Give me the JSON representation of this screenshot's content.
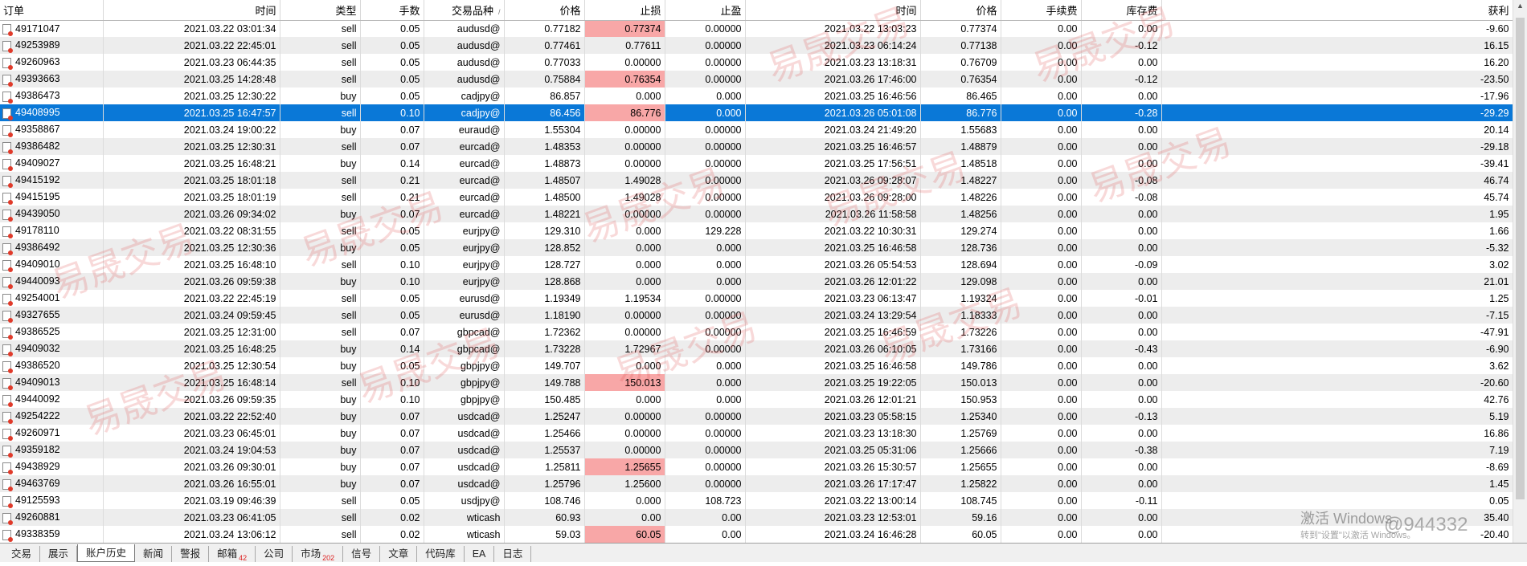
{
  "columns": [
    "订单",
    "时间",
    "类型",
    "手数",
    "交易品种",
    "价格",
    "止损",
    "止盈",
    "时间",
    "价格",
    "手续费",
    "库存费",
    "获利"
  ],
  "sort_mark": "/",
  "rows": [
    [
      "49171047",
      "2021.03.22 03:01:34",
      "sell",
      "0.05",
      "audusd@",
      "0.77182",
      "0.77374",
      "0.00000",
      "2021.03.22 13:03:23",
      "0.77374",
      "0.00",
      "0.00",
      "-9.60"
    ],
    [
      "49253989",
      "2021.03.22 22:45:01",
      "sell",
      "0.05",
      "audusd@",
      "0.77461",
      "0.77611",
      "0.00000",
      "2021.03.23 06:14:24",
      "0.77138",
      "0.00",
      "-0.12",
      "16.15"
    ],
    [
      "49260963",
      "2021.03.23 06:44:35",
      "sell",
      "0.05",
      "audusd@",
      "0.77033",
      "0.00000",
      "0.00000",
      "2021.03.23 13:18:31",
      "0.76709",
      "0.00",
      "0.00",
      "16.20"
    ],
    [
      "49393663",
      "2021.03.25 14:28:48",
      "sell",
      "0.05",
      "audusd@",
      "0.75884",
      "0.76354",
      "0.00000",
      "2021.03.26 17:46:00",
      "0.76354",
      "0.00",
      "-0.12",
      "-23.50"
    ],
    [
      "49386473",
      "2021.03.25 12:30:22",
      "buy",
      "0.05",
      "cadjpy@",
      "86.857",
      "0.000",
      "0.000",
      "2021.03.25 16:46:56",
      "86.465",
      "0.00",
      "0.00",
      "-17.96"
    ],
    [
      "49408995",
      "2021.03.25 16:47:57",
      "sell",
      "0.10",
      "cadjpy@",
      "86.456",
      "86.776",
      "0.000",
      "2021.03.26 05:01:08",
      "86.776",
      "0.00",
      "-0.28",
      "-29.29"
    ],
    [
      "49358867",
      "2021.03.24 19:00:22",
      "buy",
      "0.07",
      "euraud@",
      "1.55304",
      "0.00000",
      "0.00000",
      "2021.03.24 21:49:20",
      "1.55683",
      "0.00",
      "0.00",
      "20.14"
    ],
    [
      "49386482",
      "2021.03.25 12:30:31",
      "sell",
      "0.07",
      "eurcad@",
      "1.48353",
      "0.00000",
      "0.00000",
      "2021.03.25 16:46:57",
      "1.48879",
      "0.00",
      "0.00",
      "-29.18"
    ],
    [
      "49409027",
      "2021.03.25 16:48:21",
      "buy",
      "0.14",
      "eurcad@",
      "1.48873",
      "0.00000",
      "0.00000",
      "2021.03.25 17:56:51",
      "1.48518",
      "0.00",
      "0.00",
      "-39.41"
    ],
    [
      "49415192",
      "2021.03.25 18:01:18",
      "sell",
      "0.21",
      "eurcad@",
      "1.48507",
      "1.49028",
      "0.00000",
      "2021.03.26 09:28:07",
      "1.48227",
      "0.00",
      "-0.08",
      "46.74"
    ],
    [
      "49415195",
      "2021.03.25 18:01:19",
      "sell",
      "0.21",
      "eurcad@",
      "1.48500",
      "1.49028",
      "0.00000",
      "2021.03.26 09:28:00",
      "1.48226",
      "0.00",
      "-0.08",
      "45.74"
    ],
    [
      "49439050",
      "2021.03.26 09:34:02",
      "buy",
      "0.07",
      "eurcad@",
      "1.48221",
      "0.00000",
      "0.00000",
      "2021.03.26 11:58:58",
      "1.48256",
      "0.00",
      "0.00",
      "1.95"
    ],
    [
      "49178110",
      "2021.03.22 08:31:55",
      "sell",
      "0.05",
      "eurjpy@",
      "129.310",
      "0.000",
      "129.228",
      "2021.03.22 10:30:31",
      "129.274",
      "0.00",
      "0.00",
      "1.66"
    ],
    [
      "49386492",
      "2021.03.25 12:30:36",
      "buy",
      "0.05",
      "eurjpy@",
      "128.852",
      "0.000",
      "0.000",
      "2021.03.25 16:46:58",
      "128.736",
      "0.00",
      "0.00",
      "-5.32"
    ],
    [
      "49409010",
      "2021.03.25 16:48:10",
      "sell",
      "0.10",
      "eurjpy@",
      "128.727",
      "0.000",
      "0.000",
      "2021.03.26 05:54:53",
      "128.694",
      "0.00",
      "-0.09",
      "3.02"
    ],
    [
      "49440093",
      "2021.03.26 09:59:38",
      "buy",
      "0.10",
      "eurjpy@",
      "128.868",
      "0.000",
      "0.000",
      "2021.03.26 12:01:22",
      "129.098",
      "0.00",
      "0.00",
      "21.01"
    ],
    [
      "49254001",
      "2021.03.22 22:45:19",
      "sell",
      "0.05",
      "eurusd@",
      "1.19349",
      "1.19534",
      "0.00000",
      "2021.03.23 06:13:47",
      "1.19324",
      "0.00",
      "-0.01",
      "1.25"
    ],
    [
      "49327655",
      "2021.03.24 09:59:45",
      "sell",
      "0.05",
      "eurusd@",
      "1.18190",
      "0.00000",
      "0.00000",
      "2021.03.24 13:29:54",
      "1.18333",
      "0.00",
      "0.00",
      "-7.15"
    ],
    [
      "49386525",
      "2021.03.25 12:31:00",
      "sell",
      "0.07",
      "gbpcad@",
      "1.72362",
      "0.00000",
      "0.00000",
      "2021.03.25 16:46:59",
      "1.73226",
      "0.00",
      "0.00",
      "-47.91"
    ],
    [
      "49409032",
      "2021.03.25 16:48:25",
      "buy",
      "0.14",
      "gbpcad@",
      "1.73228",
      "1.72967",
      "0.00000",
      "2021.03.26 06:10:05",
      "1.73166",
      "0.00",
      "-0.43",
      "-6.90"
    ],
    [
      "49386520",
      "2021.03.25 12:30:54",
      "buy",
      "0.05",
      "gbpjpy@",
      "149.707",
      "0.000",
      "0.000",
      "2021.03.25 16:46:58",
      "149.786",
      "0.00",
      "0.00",
      "3.62"
    ],
    [
      "49409013",
      "2021.03.25 16:48:14",
      "sell",
      "0.10",
      "gbpjpy@",
      "149.788",
      "150.013",
      "0.000",
      "2021.03.25 19:22:05",
      "150.013",
      "0.00",
      "0.00",
      "-20.60"
    ],
    [
      "49440092",
      "2021.03.26 09:59:35",
      "buy",
      "0.10",
      "gbpjpy@",
      "150.485",
      "0.000",
      "0.000",
      "2021.03.26 12:01:21",
      "150.953",
      "0.00",
      "0.00",
      "42.76"
    ],
    [
      "49254222",
      "2021.03.22 22:52:40",
      "buy",
      "0.07",
      "usdcad@",
      "1.25247",
      "0.00000",
      "0.00000",
      "2021.03.23 05:58:15",
      "1.25340",
      "0.00",
      "-0.13",
      "5.19"
    ],
    [
      "49260971",
      "2021.03.23 06:45:01",
      "buy",
      "0.07",
      "usdcad@",
      "1.25466",
      "0.00000",
      "0.00000",
      "2021.03.23 13:18:30",
      "1.25769",
      "0.00",
      "0.00",
      "16.86"
    ],
    [
      "49359182",
      "2021.03.24 19:04:53",
      "buy",
      "0.07",
      "usdcad@",
      "1.25537",
      "0.00000",
      "0.00000",
      "2021.03.25 05:31:06",
      "1.25666",
      "0.00",
      "-0.38",
      "7.19"
    ],
    [
      "49438929",
      "2021.03.26 09:30:01",
      "buy",
      "0.07",
      "usdcad@",
      "1.25811",
      "1.25655",
      "0.00000",
      "2021.03.26 15:30:57",
      "1.25655",
      "0.00",
      "0.00",
      "-8.69"
    ],
    [
      "49463769",
      "2021.03.26 16:55:01",
      "buy",
      "0.07",
      "usdcad@",
      "1.25796",
      "1.25600",
      "0.00000",
      "2021.03.26 17:17:47",
      "1.25822",
      "0.00",
      "0.00",
      "1.45"
    ],
    [
      "49125593",
      "2021.03.19 09:46:39",
      "sell",
      "0.05",
      "usdjpy@",
      "108.746",
      "0.000",
      "108.723",
      "2021.03.22 13:00:14",
      "108.745",
      "0.00",
      "-0.11",
      "0.05"
    ],
    [
      "49260881",
      "2021.03.23 06:41:05",
      "sell",
      "0.02",
      "wticash",
      "60.93",
      "0.00",
      "0.00",
      "2021.03.23 12:53:01",
      "59.16",
      "0.00",
      "0.00",
      "35.40"
    ],
    [
      "49338359",
      "2021.03.24 13:06:12",
      "sell",
      "0.02",
      "wticash",
      "59.03",
      "60.05",
      "0.00",
      "2021.03.24 16:46:28",
      "60.05",
      "0.00",
      "0.00",
      "-20.40"
    ]
  ],
  "highlighted_sl_rows": [
    0,
    3,
    5,
    21,
    26,
    30
  ],
  "selected_row": 5,
  "tabs": [
    "交易",
    "展示",
    "账户历史",
    "新闻",
    "警报",
    "邮箱",
    "公司",
    "市场",
    "信号",
    "文章",
    "代码库",
    "EA",
    "日志"
  ],
  "tab_badges": {
    "5": "42",
    "7": "202"
  },
  "active_tab": 2,
  "watermark_text": "易晟交易",
  "os_overlay": {
    "title": "激活 Windows",
    "subtitle": "转到\"设置\"以激活 Windows。",
    "user_mark": "@944332"
  }
}
